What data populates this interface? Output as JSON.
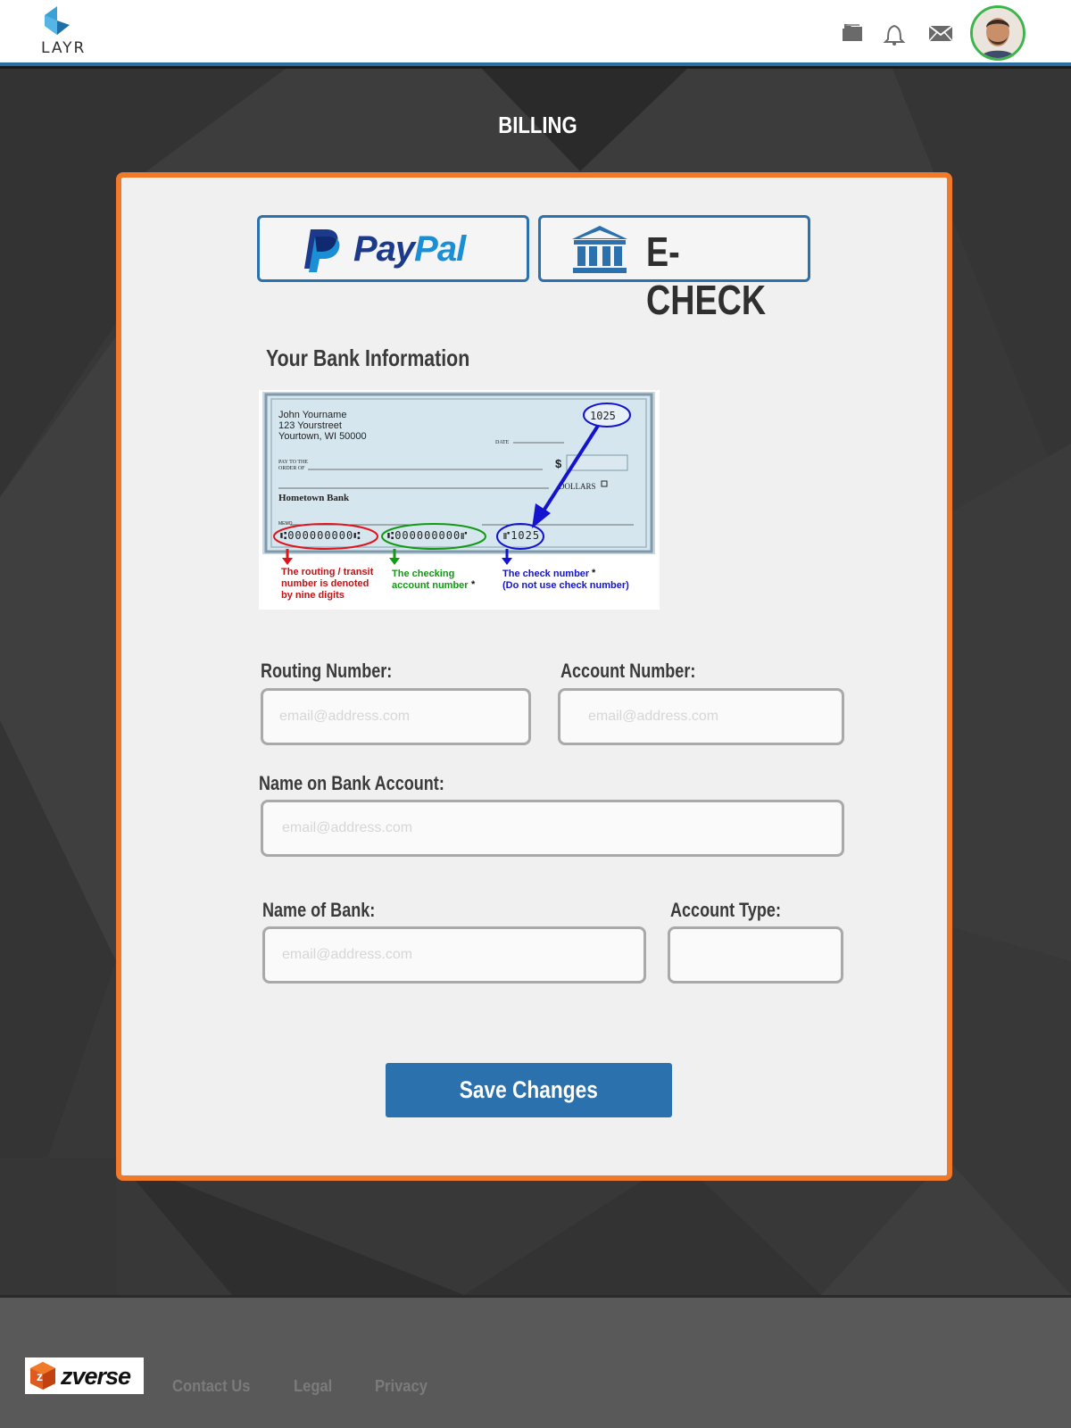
{
  "header": {
    "logo_text": "LAYR",
    "icons": [
      "folder-icon",
      "bell-icon",
      "mail-icon"
    ],
    "avatar": "user-avatar"
  },
  "page": {
    "title": "BILLING"
  },
  "payment_methods": {
    "paypal": {
      "word_pay": "Pay",
      "word_pal": "Pal",
      "icon": "paypal-logo-icon"
    },
    "echeck": {
      "label": "E-CHECK",
      "icon": "bank-icon"
    }
  },
  "bank_info": {
    "title": "Your Bank Information",
    "check_image": {
      "name_line1": "John Yourname",
      "name_line2": "123 Yourstreet",
      "name_line3": "Yourtown, WI 50000",
      "date_label": "DATE",
      "pay_to_line1": "PAY TO THE",
      "pay_to_line2": "ORDER OF",
      "dollar_sign": "$",
      "dollars_label": "DOLLARS",
      "bank_name": "Hometown Bank",
      "memo_label": "MEMO",
      "check_number": "1025",
      "routing_digits": "⑆000000000⑆",
      "account_digits": "⑆000000000⑈",
      "check_digits": "⑈1025",
      "routing_note_1": "The routing / transit",
      "routing_note_2": "number is denoted",
      "routing_note_3": "by nine digits",
      "account_note_1": "The checking",
      "account_note_2": "account number",
      "account_note_star": "*",
      "checknum_note_1": "The check number",
      "checknum_note_star": "*",
      "checknum_note_2": "(Do not use check number)"
    }
  },
  "form": {
    "routing_label": "Routing Number:",
    "routing_placeholder": "email@address.com",
    "account_label": "Account Number:",
    "account_placeholder": "email@address.com",
    "name_on_account_label": "Name on Bank Account:",
    "name_on_account_placeholder": "email@address.com",
    "bank_name_label": "Name of Bank:",
    "bank_name_placeholder": "email@address.com",
    "account_type_label": "Account Type:",
    "account_type_value": "",
    "save_label": "Save Changes"
  },
  "footer": {
    "brand": "zverse",
    "links": [
      "Contact Us",
      "Legal",
      "Privacy"
    ]
  },
  "colors": {
    "accent_blue": "#2b71ad",
    "card_border_orange": "#f07a2a",
    "avatar_ring_green": "#3cb54a",
    "paypal_dark": "#1b3a8c",
    "paypal_light": "#1b8fd6"
  }
}
